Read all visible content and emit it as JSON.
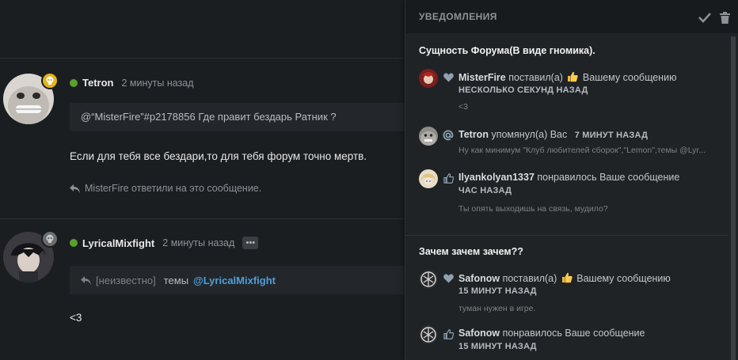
{
  "posts": [
    {
      "username": "Tetron",
      "time": "2 минуты назад",
      "quote": "@“MisterFire”#p2178856 Где правит бездарь Ратник ?",
      "text": "Если для тебя все бездари,то для тебя форум точно мертв.",
      "reply_note": "MisterFire ответили на это сообщение."
    },
    {
      "username": "LyricalMixfight",
      "time": "2 минуты назад",
      "more": "•••",
      "quote_unknown": "[неизвестно]",
      "quote_mid": "темы",
      "quote_mention": "@LyricalMixfight",
      "text": "<3"
    }
  ],
  "notifications": {
    "title": "УВЕДОМЛЕНИЯ",
    "groups": [
      {
        "title": "Сущность Форума(В виде гномика).",
        "items": [
          {
            "user": "MisterFire",
            "action": "поставил(а)",
            "action2": "Вашему сообщению",
            "time": "НЕСКОЛЬКО СЕКУНД НАЗАД",
            "snippet": "<3",
            "icon": "heart-icon"
          },
          {
            "user": "Tetron",
            "action": "упомянул(а) Вас",
            "time": "7 МИНУТ НАЗАД",
            "snippet": "Ну как минимум \"Клуб любителей сборок\",\"Lemon\",темы @Lyr...",
            "icon": "at-icon"
          },
          {
            "user": "Ilyankolyan1337",
            "action": "понравилось Ваше сообщение",
            "time": "ЧАС НАЗАД",
            "snippet": "Ты опять выходишь на связь, мудило?",
            "icon": "thumbs-up-icon"
          }
        ]
      },
      {
        "title": "Зачем зачем зачем??",
        "items": [
          {
            "user": "Safonow",
            "action": "поставил(а)",
            "action2": "Вашему сообщению",
            "time": "15 МИНУТ НАЗАД",
            "snippet": "туман нужен в игре.",
            "icon": "heart-icon"
          },
          {
            "user": "Safonow",
            "action": "понравилось Ваше сообщение",
            "time": "15 МИНУТ НАЗАД",
            "icon": "thumbs-up-icon"
          }
        ]
      }
    ]
  },
  "colors": {
    "online": "#5aa02c",
    "mention": "#4e9fd9",
    "badge_gold": "#e5b41a",
    "panel_bg": "#1f2326"
  }
}
